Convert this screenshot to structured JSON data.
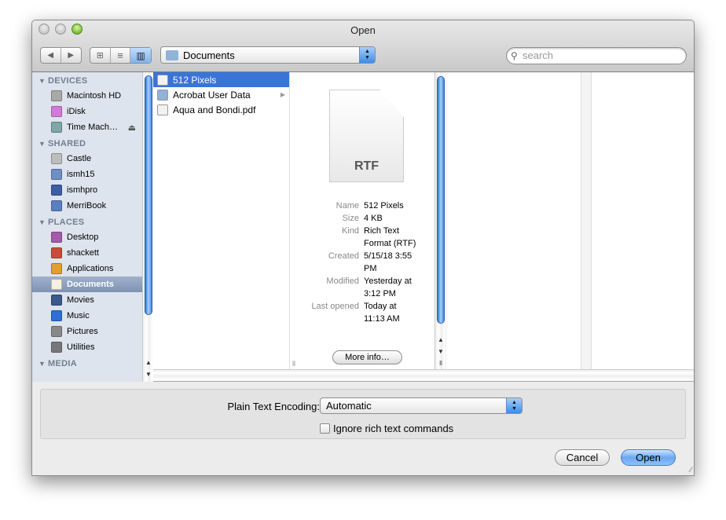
{
  "window": {
    "title": "Open"
  },
  "toolbar": {
    "back_icon": "back-arrow",
    "forward_icon": "forward-arrow",
    "views": [
      "icon-view",
      "list-view",
      "column-view"
    ],
    "location": "Documents",
    "search_placeholder": "search"
  },
  "sidebar": {
    "sections": [
      {
        "label": "DEVICES",
        "items": [
          {
            "label": "Macintosh HD",
            "color": "#a9a9a9"
          },
          {
            "label": "iDisk",
            "color": "#d37ad8"
          },
          {
            "label": "Time Mach…",
            "color": "#7fa7a7",
            "eject": "⏏"
          }
        ]
      },
      {
        "label": "SHARED",
        "items": [
          {
            "label": "Castle",
            "color": "#bdbdbd"
          },
          {
            "label": "ismh15",
            "color": "#6f8fc4"
          },
          {
            "label": "ismhpro",
            "color": "#3c5fa8"
          },
          {
            "label": "MerriBook",
            "color": "#5a7fc2"
          }
        ]
      },
      {
        "label": "PLACES",
        "items": [
          {
            "label": "Desktop",
            "color": "#a75aa8"
          },
          {
            "label": "shackett",
            "color": "#c84c3a"
          },
          {
            "label": "Applications",
            "color": "#e0a030"
          },
          {
            "label": "Documents",
            "color": "#f5f1e0",
            "selected": true
          },
          {
            "label": "Movies",
            "color": "#3b5a8a"
          },
          {
            "label": "Music",
            "color": "#2f6fd3"
          },
          {
            "label": "Pictures",
            "color": "#888888"
          },
          {
            "label": "Utilities",
            "color": "#777777"
          }
        ]
      },
      {
        "label": "MEDIA",
        "items": []
      }
    ]
  },
  "files": [
    {
      "label": "512 Pixels",
      "selected": true
    },
    {
      "label": "Acrobat User Data",
      "folder": true,
      "arrow": "▶"
    },
    {
      "label": "Aqua and Bondi.pdf"
    }
  ],
  "preview": {
    "badge": "RTF",
    "rows": [
      {
        "k": "Name",
        "v": [
          "512 Pixels"
        ]
      },
      {
        "k": "Size",
        "v": [
          "4 KB"
        ]
      },
      {
        "k": "Kind",
        "v": [
          "Rich Text",
          "Format (RTF)"
        ]
      },
      {
        "k": "Created",
        "v": [
          "5/15/18 3:55",
          "PM"
        ]
      },
      {
        "k": "Modified",
        "v": [
          "Yesterday at",
          "3:12 PM"
        ]
      },
      {
        "k": "Last opened",
        "v": [
          "Today at",
          "11:13 AM"
        ]
      }
    ],
    "more_info": "More info…"
  },
  "options": {
    "encoding_label": "Plain Text Encoding:",
    "encoding_value": "Automatic",
    "ignore_label": "Ignore rich text commands",
    "ignore_checked": false
  },
  "buttons": {
    "cancel": "Cancel",
    "open": "Open"
  }
}
